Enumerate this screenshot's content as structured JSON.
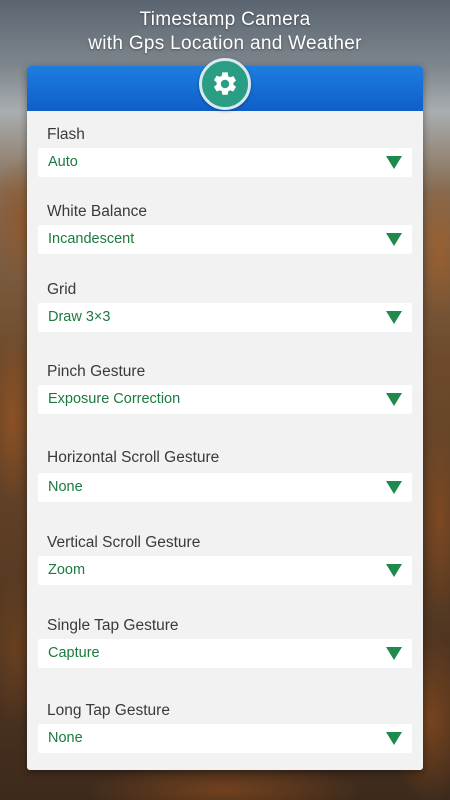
{
  "header": {
    "title_line1": "Timestamp Camera",
    "title_line2": "with Gps Location and Weather"
  },
  "panel": {
    "icon": "gear-icon",
    "accent_color": "#1976d2",
    "badge_color": "#2a9e84",
    "value_color": "#1b7a3e"
  },
  "settings": [
    {
      "label": "Flash",
      "value": "Auto"
    },
    {
      "label": "White Balance",
      "value": "Incandescent"
    },
    {
      "label": "Grid",
      "value": "Draw 3×3"
    },
    {
      "label": "Pinch Gesture",
      "value": "Exposure Correction"
    },
    {
      "label": "Horizontal Scroll Gesture",
      "value": "None"
    },
    {
      "label": "Vertical Scroll Gesture",
      "value": "Zoom"
    },
    {
      "label": "Single Tap Gesture",
      "value": "Capture"
    },
    {
      "label": "Long Tap Gesture",
      "value": "None"
    }
  ]
}
